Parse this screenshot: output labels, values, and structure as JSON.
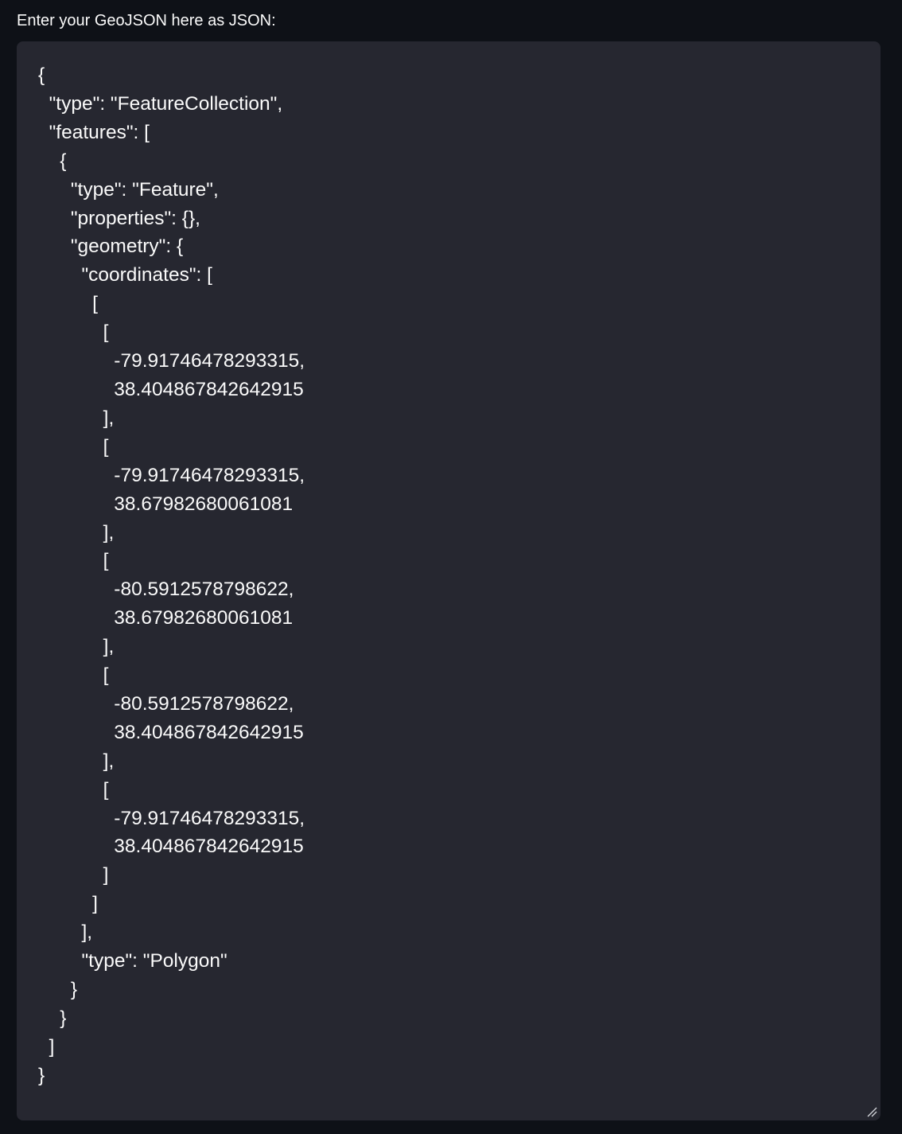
{
  "field": {
    "label": "Enter your GeoJSON here as JSON:",
    "value": "{\n  \"type\": \"FeatureCollection\",\n  \"features\": [\n    {\n      \"type\": \"Feature\",\n      \"properties\": {},\n      \"geometry\": {\n        \"coordinates\": [\n          [\n            [\n              -79.91746478293315,\n              38.404867842642915\n            ],\n            [\n              -79.91746478293315,\n              38.67982680061081\n            ],\n            [\n              -80.5912578798622,\n              38.67982680061081\n            ],\n            [\n              -80.5912578798622,\n              38.404867842642915\n            ],\n            [\n              -79.91746478293315,\n              38.404867842642915\n            ]\n          ]\n        ],\n        \"type\": \"Polygon\"\n      }\n    }\n  ]\n}",
    "resize_icon": "resize-grip-icon"
  },
  "colors": {
    "page_background": "#0e1117",
    "field_background": "#262730",
    "text": "#fafafa"
  }
}
